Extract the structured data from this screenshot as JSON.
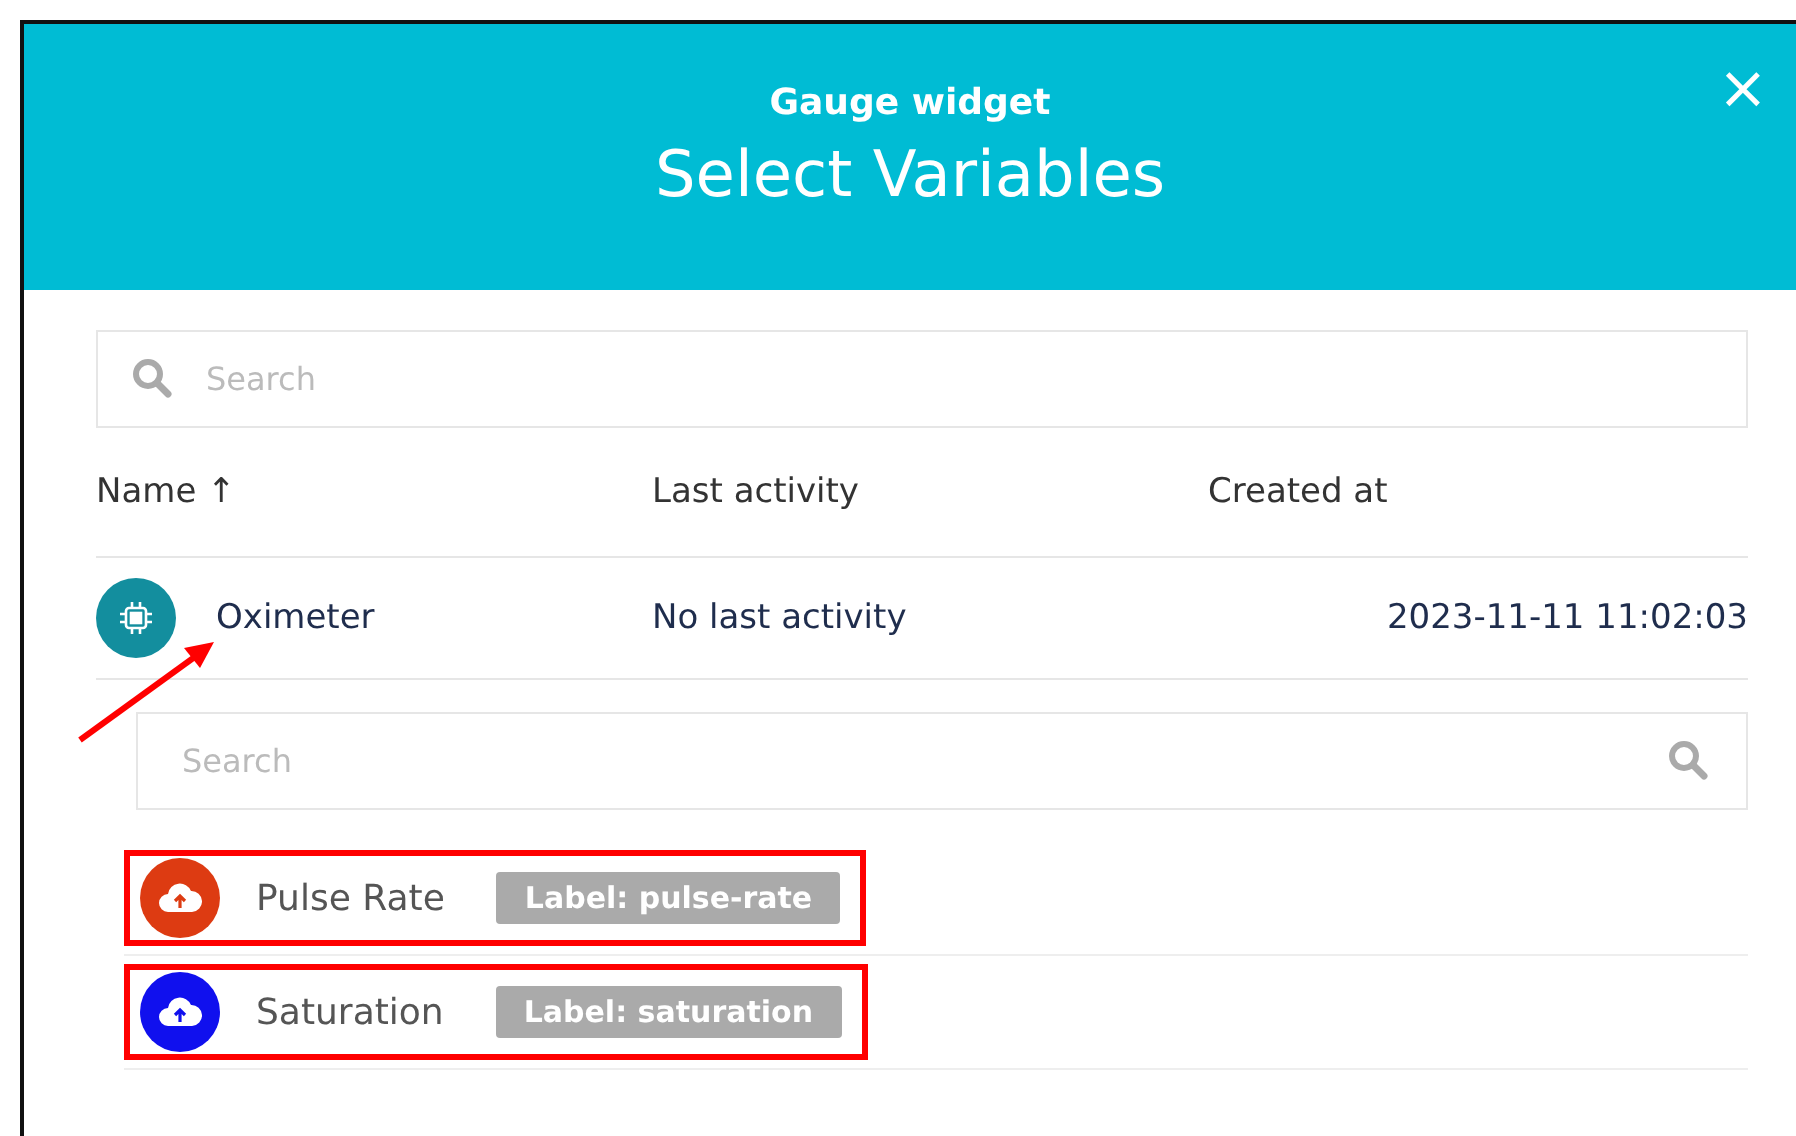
{
  "dialog": {
    "subtitle": "Gauge widget",
    "title": "Select Variables",
    "close": "×"
  },
  "search": {
    "placeholder": "Search"
  },
  "table": {
    "columns": [
      {
        "label": "Name",
        "sort": "↑"
      },
      {
        "label": "Last activity"
      },
      {
        "label": "Created at"
      }
    ],
    "rows": [
      {
        "name": "Oximeter",
        "last_activity": "No last activity",
        "created_at": "2023-11-11 11:02:03"
      }
    ]
  },
  "variable_search": {
    "placeholder": "Search"
  },
  "variables": [
    {
      "name": "Pulse Rate",
      "label": "Label: pulse-rate",
      "color": "#dd3b12",
      "highlighted": true
    },
    {
      "name": "Saturation",
      "label": "Label: saturation",
      "color": "#1010ee",
      "highlighted": true
    }
  ]
}
